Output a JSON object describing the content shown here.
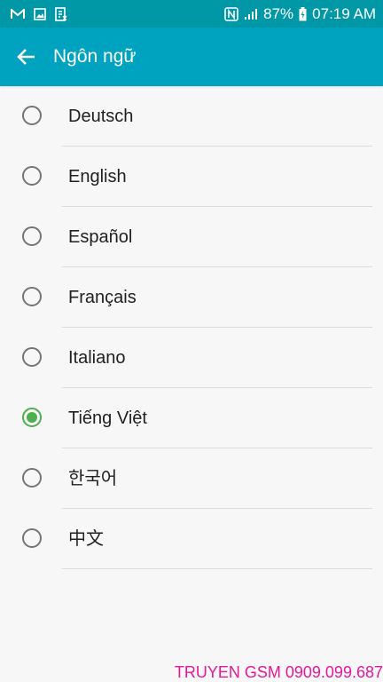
{
  "status_bar": {
    "left_icons": [
      "gmail-icon",
      "image-icon",
      "usb-debug-icon"
    ],
    "nfc_icon": "nfc-icon",
    "signal_icon": "signal-icon",
    "battery": "87%",
    "battery_icon": "battery-charging-icon",
    "time": "07:19 AM"
  },
  "app_bar": {
    "back_icon": "back-arrow-icon",
    "title": "Ngôn ngữ"
  },
  "languages": [
    {
      "label": "Deutsch",
      "selected": false
    },
    {
      "label": "English",
      "selected": false
    },
    {
      "label": "Español",
      "selected": false
    },
    {
      "label": "Français",
      "selected": false
    },
    {
      "label": "Italiano",
      "selected": false
    },
    {
      "label": "Tiếng Việt",
      "selected": true
    },
    {
      "label": "한국어",
      "selected": false
    },
    {
      "label": "中文",
      "selected": false
    }
  ],
  "watermark": "TRUYEN GSM 0909.099.687",
  "colors": {
    "status_bar": "#0097a7",
    "app_bar": "#00a3bf",
    "selected_radio": "#4caf50",
    "watermark": "#e8189a"
  }
}
